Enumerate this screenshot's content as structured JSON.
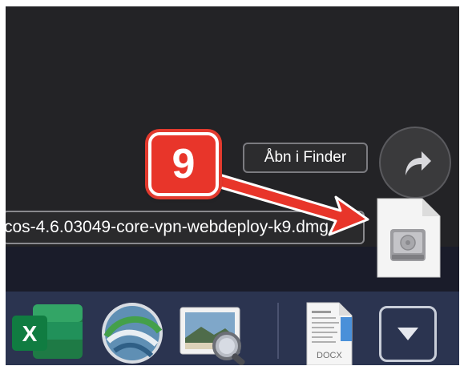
{
  "popup": {
    "open_in_finder": "Åbn i Finder",
    "filename": "cos-4.6.03049-core-vpn-webdeploy-k9.dmg"
  },
  "annotation": {
    "step_number": "9",
    "color": "#e8352a"
  },
  "dock": {
    "apps": [
      "excel-icon",
      "anyconnect-icon",
      "preview-icon"
    ],
    "docx_label": "DOCX"
  }
}
